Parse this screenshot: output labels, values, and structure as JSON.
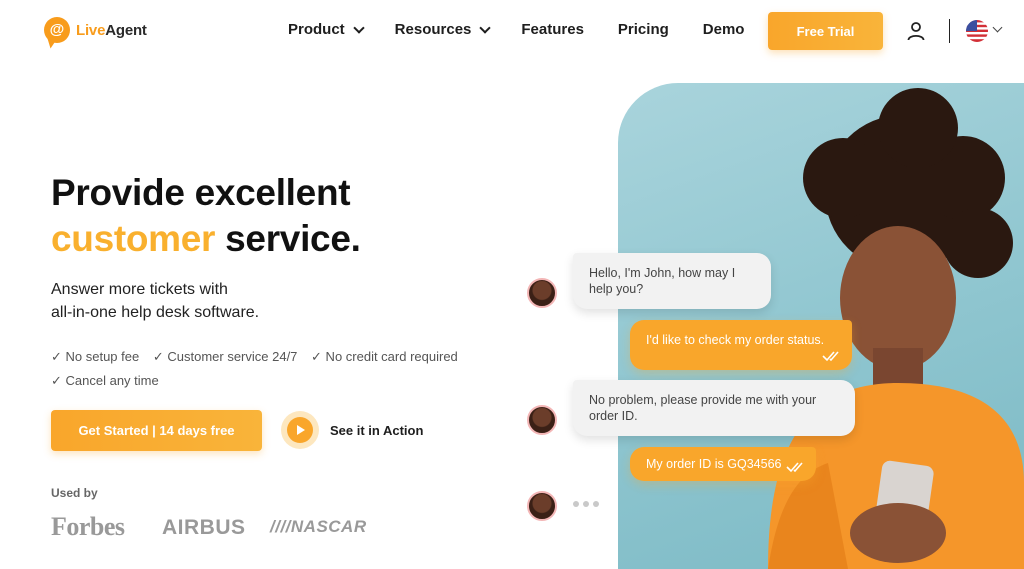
{
  "header": {
    "logo": {
      "text_main": "Live",
      "text_accent": "Agent"
    },
    "nav": [
      {
        "label": "Product",
        "dropdown": true
      },
      {
        "label": "Resources",
        "dropdown": true
      },
      {
        "label": "Features",
        "dropdown": false
      },
      {
        "label": "Pricing",
        "dropdown": false
      },
      {
        "label": "Demo",
        "dropdown": false
      }
    ],
    "cta_label": "Free Trial",
    "icons": [
      "user-icon",
      "us-flag-icon",
      "chevron-down-icon"
    ]
  },
  "hero": {
    "title_line1": "Provide excellent",
    "title_accent": "customer",
    "title_line2_rest": " service.",
    "subtitle_line1": "Answer more tickets with",
    "subtitle_line2": "all-in-one help desk software.",
    "checks": [
      "✓ No setup fee",
      "✓ Customer service 24/7",
      "✓ No credit card required",
      "✓ Cancel any time"
    ],
    "primary_cta": "Get Started | 14 days free",
    "secondary_cta": "See it in Action",
    "used_by_label": "Used by",
    "brands": [
      "Forbes",
      "AIRBUS",
      "////NASCAR"
    ]
  },
  "chat": {
    "messages": [
      {
        "from": "agent",
        "text": "Hello, I'm John, how may I help you?"
      },
      {
        "from": "user",
        "text": "I'd like to check my order status."
      },
      {
        "from": "agent",
        "text": "No problem, please provide me with your order ID."
      },
      {
        "from": "user",
        "text": "My order ID is GQ34566"
      }
    ]
  },
  "colors": {
    "accent": "#f9a62b",
    "accent_text": "#f9b02e",
    "photo_bg": "#8ec5cf"
  }
}
